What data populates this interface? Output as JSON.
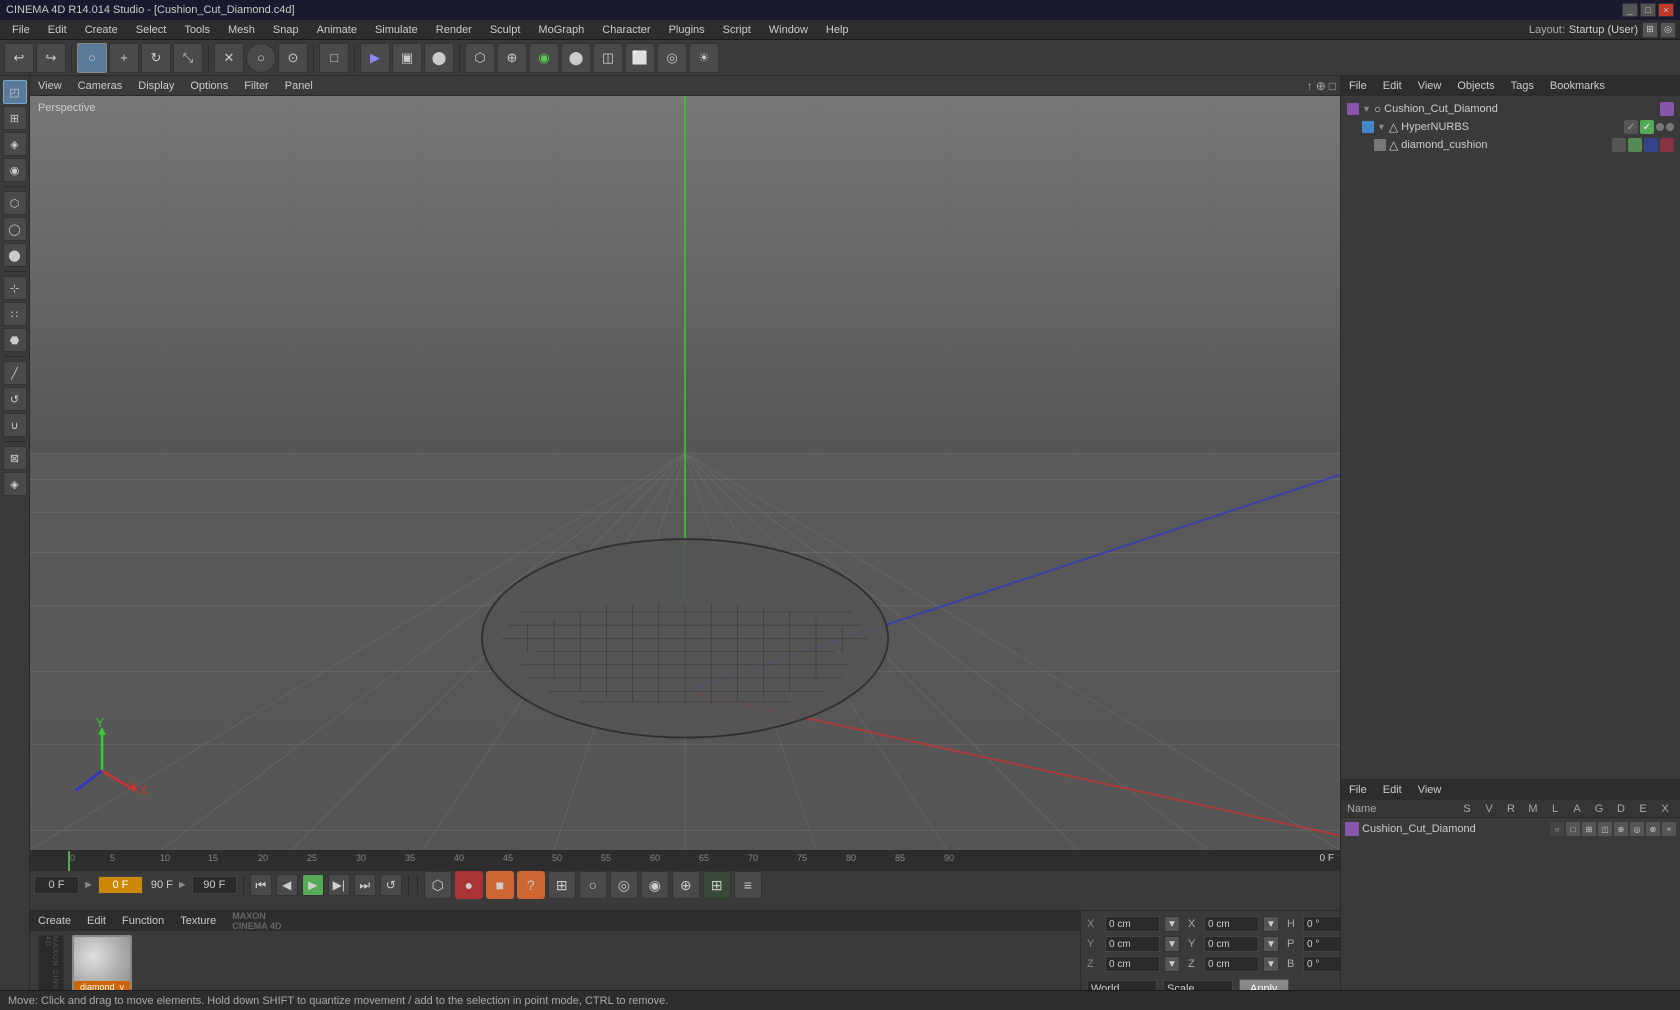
{
  "window": {
    "title": "CINEMA 4D R14.014 Studio - [Cushion_Cut_Diamond.c4d]",
    "controls": [
      "_",
      "□",
      "×"
    ]
  },
  "menubar": {
    "items": [
      "File",
      "Edit",
      "Create",
      "Select",
      "Tools",
      "Mesh",
      "Snap",
      "Animate",
      "Simulate",
      "Render",
      "Sculpt",
      "MoGraph",
      "Character",
      "Plugins",
      "Script",
      "Window",
      "Help"
    ]
  },
  "layout": {
    "label": "Layout:",
    "value": "Startup (User)"
  },
  "viewport": {
    "label": "Perspective",
    "menus": [
      "View",
      "Cameras",
      "Display",
      "Options",
      "Filter",
      "Panel"
    ]
  },
  "object_manager": {
    "menus": [
      "File",
      "Edit",
      "View",
      "Objects",
      "Tags",
      "Bookmarks"
    ],
    "tree": [
      {
        "name": "Cushion_Cut_Diamond",
        "level": 0,
        "expanded": true,
        "has_arrow": true,
        "color": "purple",
        "tags": [
          "purple"
        ]
      },
      {
        "name": "HyperNURBS",
        "level": 1,
        "expanded": true,
        "has_arrow": true,
        "color": "blue",
        "tags": [
          "gray",
          "green"
        ]
      },
      {
        "name": "diamond_cushion",
        "level": 2,
        "expanded": false,
        "has_arrow": false,
        "color": "gray",
        "tags": [
          "gray",
          "gray",
          "gray"
        ]
      }
    ]
  },
  "attribute_manager": {
    "menus": [
      "File",
      "Edit",
      "View"
    ],
    "columns": [
      "Name",
      "S",
      "V",
      "R",
      "M",
      "L",
      "A",
      "G",
      "D",
      "E",
      "X"
    ],
    "items": [
      {
        "name": "Cushion_Cut_Diamond",
        "color": "purple"
      }
    ]
  },
  "timeline": {
    "markers": [
      "0",
      "5",
      "10",
      "15",
      "20",
      "25",
      "30",
      "35",
      "40",
      "45",
      "50",
      "55",
      "60",
      "65",
      "70",
      "75",
      "80",
      "85",
      "90"
    ],
    "current_frame": "0 F",
    "start_frame": "0 F",
    "end_frame": "90 F",
    "max_frame": "90 F",
    "frame_indicator": "0 F"
  },
  "transport": {
    "buttons": [
      "⏮",
      "⏪",
      "▶",
      "⏩",
      "⏭"
    ],
    "record_buttons": [
      "●",
      "⬛",
      "?"
    ],
    "right_icons": [
      "grid",
      "circle",
      "circle",
      "circle",
      "circle",
      "grid",
      "grid"
    ]
  },
  "materials": {
    "toolbar": [
      "Create",
      "Edit",
      "Function",
      "Texture"
    ],
    "items": [
      {
        "name": "diamond_v",
        "preview_type": "sphere"
      }
    ]
  },
  "coordinates": {
    "position": {
      "x": "0 cm",
      "y": "0 cm",
      "z": "0 cm",
      "label": "X"
    },
    "scale": {
      "x": "0 cm",
      "y": "0 cm",
      "z": "0 cm"
    },
    "rotation": {
      "h": "0 °",
      "p": "0 °",
      "b": "0 °"
    },
    "coord_labels": {
      "x1": "X",
      "y1": "Y",
      "z1": "Z",
      "x2": "X",
      "y2": "Y",
      "z2": "Z",
      "h": "H",
      "p": "P",
      "b": "B"
    },
    "dropdown1": "World",
    "dropdown2": "Scale",
    "apply_btn": "Apply"
  },
  "status_bar": {
    "text": "Move: Click and drag to move elements. Hold down SHIFT to quantize movement / add to the selection in point mode, CTRL to remove."
  },
  "icons": {
    "undo": "↩",
    "redo": "↪",
    "new_obj": "+",
    "live_select": "○",
    "move": "✛",
    "rotate": "↻",
    "scale": "⤡",
    "render": "▶",
    "edit_render": "▣",
    "interactive_render": "⬤",
    "perspective": "□",
    "camera": "◎",
    "light": "☀",
    "play": "▶",
    "stop": "■"
  }
}
